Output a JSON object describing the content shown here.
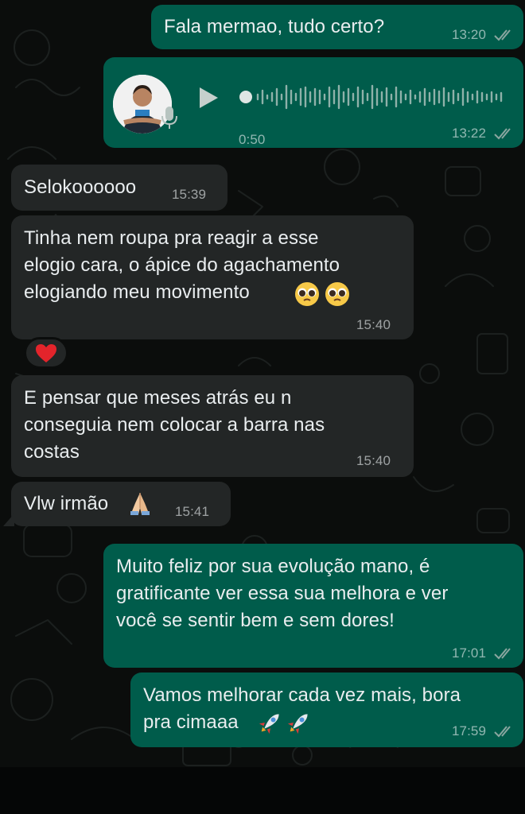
{
  "chat": {
    "messages": [
      {
        "id": "m1",
        "direction": "outgoing",
        "text": "Fala mermao, tudo certo?",
        "time": "13:20",
        "read": true
      },
      {
        "id": "m2",
        "direction": "outgoing",
        "type": "voice",
        "duration": "0:50",
        "time": "13:22",
        "read": true
      },
      {
        "id": "m3",
        "direction": "incoming",
        "text": "Selokoooooo",
        "time": "15:39"
      },
      {
        "id": "m4",
        "direction": "incoming",
        "text": "Tinha nem roupa pra reagir a esse\nelogio cara, o ápice do agachamento\nelogiando meu movimento",
        "emoji": "pleading-face-emoji ×2",
        "time": "15:40",
        "reaction": "heart-emoji"
      },
      {
        "id": "m5",
        "direction": "incoming",
        "text": "E pensar que meses atrás eu n\nconseguia nem colocar a barra nas\ncostas",
        "time": "15:40"
      },
      {
        "id": "m6",
        "direction": "incoming",
        "text": "Vlw irmão",
        "emoji": "folded-hands-emoji",
        "time": "15:41"
      },
      {
        "id": "m7",
        "direction": "outgoing",
        "text": "Muito feliz por sua evolução mano, é\ngratificante ver essa sua melhora e ver\nvocê se sentir bem e sem dores!",
        "time": "17:01",
        "read": true
      },
      {
        "id": "m8",
        "direction": "outgoing",
        "text": "Vamos melhorar cada vez mais, bora\npra cimaaa",
        "emoji": "rocket-emoji ×2",
        "time": "17:59",
        "read": true
      }
    ]
  },
  "colors": {
    "outgoing_bubble": "#005c4b",
    "incoming_bubble": "#232626",
    "background": "#0b0d0c",
    "read_ticks": "#8aa6a0"
  }
}
